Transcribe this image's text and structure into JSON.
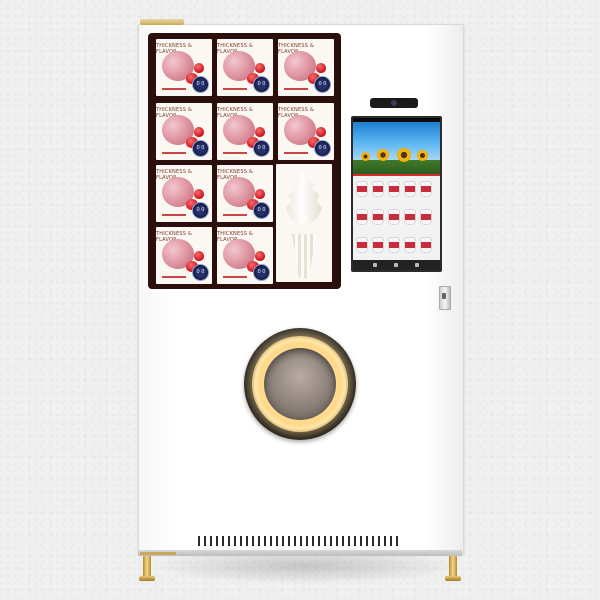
{
  "brand_text": "THICKNESS & FLAVOR",
  "badge_text": "0 0",
  "product_cards": [
    {
      "id": 1
    },
    {
      "id": 2
    },
    {
      "id": 3
    },
    {
      "id": 4
    },
    {
      "id": 5
    },
    {
      "id": 6
    },
    {
      "id": 7
    },
    {
      "id": 8
    },
    {
      "id": 9
    },
    {
      "id": 10
    }
  ],
  "colors": {
    "panel_background": "#2a0f0d",
    "machine_body": "#ffffff",
    "light_ring": "#ffd98a",
    "trim_gold": "#c9a95a"
  },
  "icons": {
    "camera": "camera-icon",
    "lock": "lock-icon",
    "dispenser": "dispenser-outlet-icon",
    "vent": "vent-grille-icon"
  }
}
